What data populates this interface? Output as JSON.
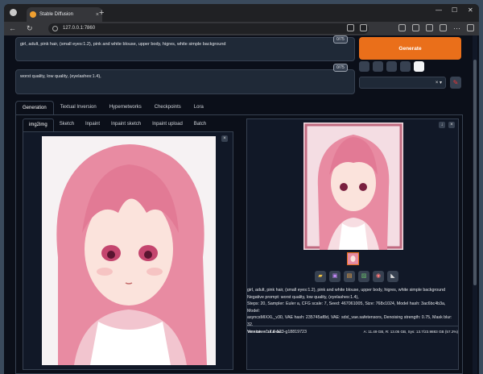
{
  "browser": {
    "tab_title": "Stable Diffusion",
    "url": "127.0.0.1:7860",
    "new_tab_symbol": "+",
    "tab_close_symbol": "×",
    "window_controls": [
      "—",
      "☐",
      "✕"
    ]
  },
  "prompts": {
    "positive": "girl, adult, pink hair, (small eyes:1.2), pink and white blouse, upper body, higres, white simple background",
    "positive_tokens": "0/75",
    "negative": "worst quality, low quality, (eyelashes:1.4),",
    "negative_tokens": "0/75"
  },
  "generate_label": "Generate",
  "styles": {
    "clear_symbol": "× ▾"
  },
  "main_tabs": [
    "Generation",
    "Textual Inversion",
    "Hypernetworks",
    "Checkpoints",
    "Lora"
  ],
  "main_tab_selected": "Generation",
  "sub_tabs": [
    "img2img",
    "Sketch",
    "Inpaint",
    "Inpaint sketch",
    "Inpaint upload",
    "Batch"
  ],
  "sub_tab_selected": "img2img",
  "output": {
    "info_lines": [
      "girl, adult, pink hair, (small eyes:1.2), pink and white blouse, upper body, higres, white simple background",
      "Negative prompt: worst quality, low quality, (eyelashes:1.4),",
      "Steps: 20, Sampler: Euler a, CFG scale: 7, Seed: 467061005, Size: 768x1024, Model hash: 3ac6bc4b3a, Model:",
      "asyncsMIXXL_v30, VAE hash: 235745af8d, VAE: sdxl_vae.safetensors, Denoising strength: 0.75, Mask blur: 32,",
      "Version: v1.7.0-523-g18819723"
    ],
    "time_taken_label": "Time taken:",
    "time_taken": "16.6 sec.",
    "memory": "A: 11.49 GB, R: 13.05 GB, Sys: 13.7/23.9883 GB (57.2%)"
  },
  "colors": {
    "accent": "#ea6f1a",
    "bg": "#0b0f19",
    "panel": "#111827",
    "border": "#374151"
  },
  "icons": [
    "folder-icon",
    "save-icon",
    "zip-icon",
    "send-to-img2img-icon",
    "send-to-inpaint-icon",
    "send-to-extras-icon"
  ]
}
